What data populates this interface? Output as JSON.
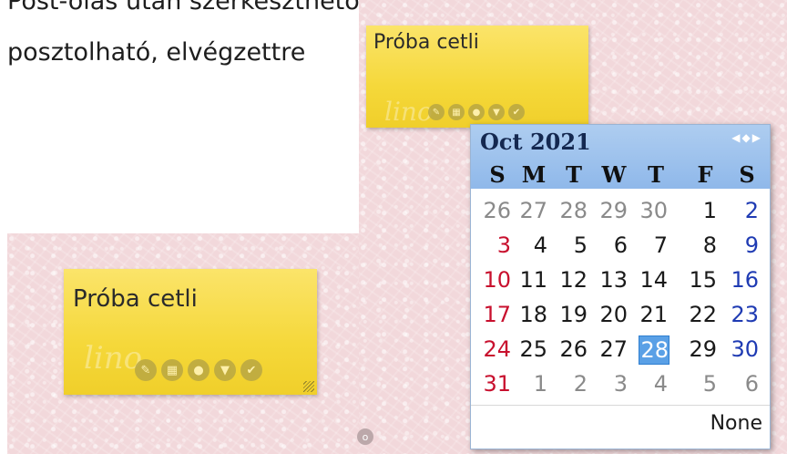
{
  "background_text": {
    "line1": "Post-olás után szerkeszthető, áthelyezhető, letölthető, újra",
    "line2": "posztolható, elvégzettre"
  },
  "note_small": {
    "title": "Próba cetli",
    "watermark": "lino"
  },
  "note_large": {
    "title": "Próba cetli",
    "watermark": "lino"
  },
  "note_icons": [
    "edit-icon",
    "calendar-icon",
    "person-icon",
    "download-icon",
    "check-icon"
  ],
  "calendar": {
    "month_label": "Oct 2021",
    "nav": {
      "prev": "◀",
      "today": "◆",
      "next": "▶"
    },
    "weekdays": [
      "S",
      "M",
      "T",
      "W",
      "T",
      "F",
      "S"
    ],
    "weeks": [
      [
        "26",
        "27",
        "28",
        "29",
        "30",
        "1",
        "2"
      ],
      [
        "3",
        "4",
        "5",
        "6",
        "7",
        "8",
        "9"
      ],
      [
        "10",
        "11",
        "12",
        "13",
        "14",
        "15",
        "16"
      ],
      [
        "17",
        "18",
        "19",
        "20",
        "21",
        "22",
        "23"
      ],
      [
        "24",
        "25",
        "26",
        "27",
        "28",
        "29",
        "30"
      ],
      [
        "31",
        "1",
        "2",
        "3",
        "4",
        "5",
        "6"
      ]
    ],
    "selected_day": "28",
    "none_label": "None"
  },
  "colors": {
    "sunday": "#c8102e",
    "saturday": "#1f3bb3",
    "selected": "#5aa0e6",
    "note": "#f5d83a"
  }
}
